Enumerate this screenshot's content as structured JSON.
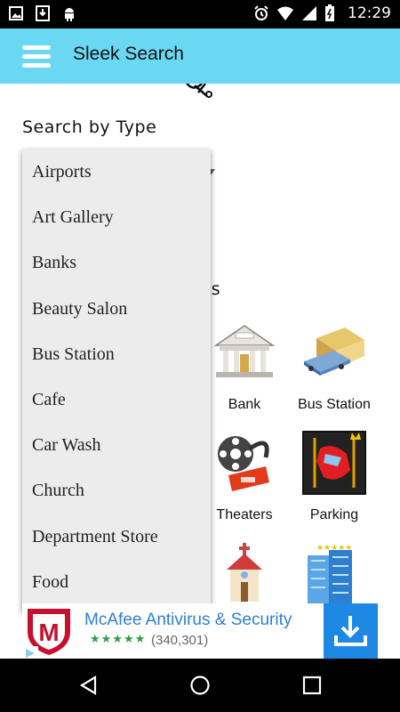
{
  "status_bar": {
    "left_icons": [
      "image-icon",
      "download-icon",
      "android-icon"
    ],
    "right_icons": [
      "alarm-icon",
      "wifi-icon",
      "signal-icon",
      "battery-icon"
    ],
    "time": "12:29"
  },
  "app_bar": {
    "title": "Sleek Search",
    "menu_icon": "hamburger-menu-icon"
  },
  "content": {
    "section_title": "Search by Type",
    "places_heading_fragment": "es",
    "grid": [
      {
        "label": "Bank",
        "icon": "bank-icon"
      },
      {
        "label": "Bus Station",
        "icon": "bus-station-icon"
      },
      {
        "label": "Theaters",
        "icon": "theaters-icon"
      },
      {
        "label": "Parking",
        "icon": "parking-icon"
      },
      {
        "label": "",
        "icon": "church-icon"
      },
      {
        "label": "",
        "icon": "building-icon"
      }
    ]
  },
  "dropdown": {
    "items": [
      "Airports",
      "Art Gallery",
      "Banks",
      "Beauty Salon",
      "Bus Station",
      "Cafe",
      "Car Wash",
      "Church",
      "Department Store",
      "Food"
    ]
  },
  "ad": {
    "title": "McAfee Antivirus & Security",
    "stars": "★★★★★",
    "count": "(340,301)",
    "logo_text": "M"
  },
  "colors": {
    "app_bar": "#6ad8f3",
    "ad_blue": "#1e88e5",
    "ad_title": "#2c7fd6"
  }
}
